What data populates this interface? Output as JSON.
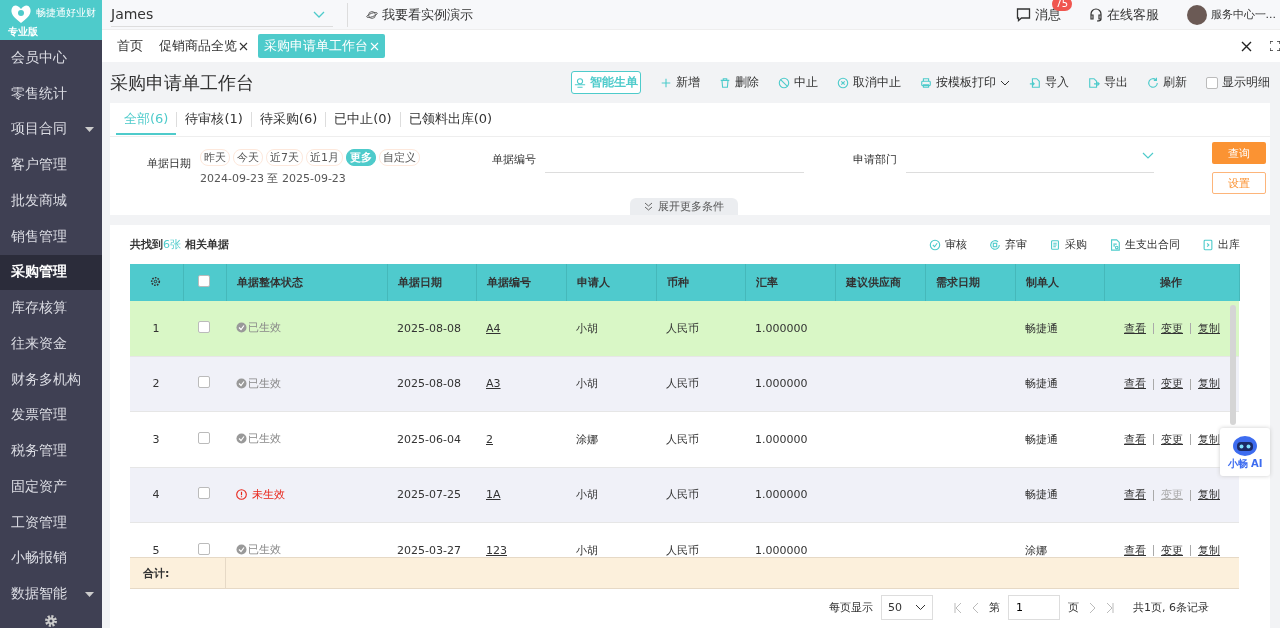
{
  "sidebar": {
    "logo": {
      "name": "畅捷通好业财",
      "edition": "专业版"
    },
    "items": [
      {
        "label": "会员中心",
        "selected": false,
        "expandable": false
      },
      {
        "label": "零售统计",
        "selected": false,
        "expandable": false
      },
      {
        "label": "项目合同",
        "selected": false,
        "expandable": true
      },
      {
        "label": "客户管理",
        "selected": false,
        "expandable": false
      },
      {
        "label": "批发商城",
        "selected": false,
        "expandable": false
      },
      {
        "label": "销售管理",
        "selected": false,
        "expandable": false
      },
      {
        "label": "采购管理",
        "selected": true,
        "expandable": false
      },
      {
        "label": "库存核算",
        "selected": false,
        "expandable": false
      },
      {
        "label": "往来资金",
        "selected": false,
        "expandable": false
      },
      {
        "label": "财务多机构",
        "selected": false,
        "expandable": false
      },
      {
        "label": "发票管理",
        "selected": false,
        "expandable": false
      },
      {
        "label": "税务管理",
        "selected": false,
        "expandable": false
      },
      {
        "label": "固定资产",
        "selected": false,
        "expandable": false
      },
      {
        "label": "工资管理",
        "selected": false,
        "expandable": false
      },
      {
        "label": "小畅报销",
        "selected": false,
        "expandable": false
      },
      {
        "label": "数据智能",
        "selected": false,
        "expandable": true
      }
    ]
  },
  "topbar": {
    "account": "James",
    "demo": "我要看实例演示",
    "messages": {
      "label": "消息",
      "badge": "75"
    },
    "support": "在线客服",
    "user": "服务中心一..."
  },
  "page_tabs": [
    {
      "label": "首页",
      "closable": false,
      "selected": false
    },
    {
      "label": "促销商品全览",
      "closable": true,
      "selected": false
    },
    {
      "label": "采购申请单工作台",
      "closable": true,
      "selected": true
    }
  ],
  "page": {
    "title": "采购申请单工作台",
    "toolbar": [
      {
        "kind": "ai",
        "label": "智能生单"
      },
      {
        "kind": "add",
        "label": "新增"
      },
      {
        "kind": "delete",
        "label": "删除"
      },
      {
        "kind": "stop",
        "label": "中止"
      },
      {
        "kind": "unstop",
        "label": "取消中止"
      },
      {
        "kind": "print",
        "label": "按模板打印"
      },
      {
        "kind": "import",
        "label": "导入"
      },
      {
        "kind": "export",
        "label": "导出"
      },
      {
        "kind": "refresh",
        "label": "刷新"
      },
      {
        "kind": "checkbox",
        "label": "显示明细",
        "checked": false
      }
    ]
  },
  "status_tabs": [
    {
      "label": "全部(6)",
      "selected": true
    },
    {
      "label": "待审核(1)",
      "selected": false
    },
    {
      "label": "待采购(6)",
      "selected": false
    },
    {
      "label": "已中止(0)",
      "selected": false
    },
    {
      "label": "已领料出库(0)",
      "selected": false
    }
  ],
  "filters": {
    "date_label": "单据日期",
    "ranges": [
      {
        "label": "昨天",
        "selected": false
      },
      {
        "label": "今天",
        "selected": false
      },
      {
        "label": "近7天",
        "selected": false
      },
      {
        "label": "近1月",
        "selected": false
      },
      {
        "label": "更多",
        "selected": true
      },
      {
        "label": "自定义",
        "selected": false
      }
    ],
    "date_range": "2024-09-23 至 2025-09-23",
    "doc_no_label": "单据编号",
    "dept_label": "申请部门",
    "query": "查询",
    "settings": "设置",
    "expand": "展开更多条件"
  },
  "results": {
    "prefix": "共找到",
    "count": "6张",
    "suffix": " 相关单据",
    "actions": [
      {
        "kind": "audit",
        "label": "审核"
      },
      {
        "kind": "unaudit",
        "label": "弃审"
      },
      {
        "kind": "purchase",
        "label": "采购"
      },
      {
        "kind": "contract",
        "label": "生支出合同"
      },
      {
        "kind": "outbound",
        "label": "出库"
      }
    ]
  },
  "table": {
    "columns": [
      "单据整体状态",
      "单据日期",
      "单据编号",
      "申请人",
      "币种",
      "汇率",
      "建议供应商",
      "需求日期",
      "制单人",
      "操作"
    ],
    "rows": [
      {
        "index": "1",
        "selected": true,
        "checked": false,
        "status": {
          "kind": "effective",
          "label": "已生效"
        },
        "date": "2025-08-08",
        "doc_no": "A4",
        "applicant": "小胡",
        "currency": "人民币",
        "rate": "1.000000",
        "maker": "畅捷通",
        "ops": [
          {
            "label": "查看",
            "disabled": false
          },
          {
            "label": "变更",
            "disabled": false
          },
          {
            "label": "复制",
            "disabled": false
          }
        ]
      },
      {
        "index": "2",
        "selected": false,
        "checked": false,
        "status": {
          "kind": "effective",
          "label": "已生效"
        },
        "date": "2025-08-08",
        "doc_no": "A3",
        "applicant": "小胡",
        "currency": "人民币",
        "rate": "1.000000",
        "maker": "畅捷通",
        "ops": [
          {
            "label": "查看",
            "disabled": false
          },
          {
            "label": "变更",
            "disabled": false
          },
          {
            "label": "复制",
            "disabled": false
          }
        ]
      },
      {
        "index": "3",
        "selected": false,
        "checked": false,
        "status": {
          "kind": "effective",
          "label": "已生效"
        },
        "date": "2025-06-04",
        "doc_no": "2",
        "applicant": "涂娜",
        "currency": "人民币",
        "rate": "1.000000",
        "maker": "畅捷通",
        "ops": [
          {
            "label": "查看",
            "disabled": false
          },
          {
            "label": "变更",
            "disabled": false
          },
          {
            "label": "复制",
            "disabled": false
          }
        ]
      },
      {
        "index": "4",
        "selected": false,
        "checked": false,
        "status": {
          "kind": "ineffective",
          "label": "未生效"
        },
        "date": "2025-07-25",
        "doc_no": "1A",
        "applicant": "小胡",
        "currency": "人民币",
        "rate": "1.000000",
        "maker": "畅捷通",
        "ops": [
          {
            "label": "查看",
            "disabled": false
          },
          {
            "label": "变更",
            "disabled": true
          },
          {
            "label": "复制",
            "disabled": false
          }
        ]
      },
      {
        "index": "5",
        "selected": false,
        "checked": false,
        "status": {
          "kind": "effective",
          "label": "已生效"
        },
        "date": "2025-03-27",
        "doc_no": "123",
        "applicant": "小胡",
        "currency": "人民币",
        "rate": "1.000000",
        "maker": "涂娜",
        "ops": [
          {
            "label": "查看",
            "disabled": false
          },
          {
            "label": "变更",
            "disabled": false
          },
          {
            "label": "复制",
            "disabled": false
          }
        ]
      }
    ],
    "select_all_checked": false,
    "total_label": "合计:"
  },
  "pagination": {
    "per_page_label": "每页显示",
    "per_page": "50",
    "page_prefix": "第",
    "page": "1",
    "page_suffix": "页",
    "summary": "共1页, 6条记录"
  },
  "assistant": {
    "label": "小畅 AI"
  }
}
